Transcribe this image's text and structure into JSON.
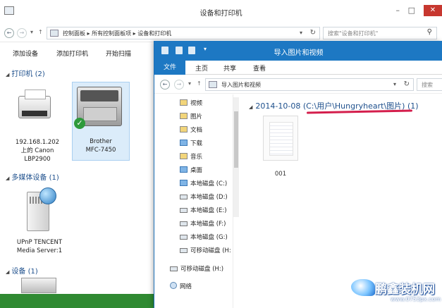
{
  "back_window": {
    "title": "设备和打印机",
    "breadcrumb": "控制面板 ▸ 所有控制面板项 ▸ 设备和打印机",
    "search_placeholder": "搜索\"设备和打印机\"",
    "toolbar": [
      "添加设备",
      "添加打印机",
      "开始扫描"
    ],
    "groups": {
      "printers": "打印机 (2)",
      "multimedia": "多媒体设备 (1)",
      "devices": "设备 (1)"
    },
    "printer_devices": [
      {
        "lines": [
          "192.168.1.202",
          "上的 Canon",
          "LBP2900"
        ]
      },
      {
        "lines": [
          "Brother",
          "MFC-7450"
        ]
      }
    ],
    "media_device": {
      "lines": [
        "UPnP TENCENT",
        "Media Server:1"
      ]
    }
  },
  "front_window": {
    "title": "导入图片和视频",
    "ribbon_tabs": [
      "文件",
      "主页",
      "共享",
      "查看"
    ],
    "breadcrumb": "导入图片和视频",
    "search_placeholder": "搜索",
    "nav_items": [
      "视频",
      "图片",
      "文档",
      "下载",
      "音乐",
      "桌面",
      "本地磁盘 (C:)",
      "本地磁盘 (D:)",
      "本地磁盘 (E:)",
      "本地磁盘 (F:)",
      "本地磁盘 (G:)",
      "可移动磁盘 (H:",
      "可移动磁盘 (H:)",
      "网络"
    ],
    "group_header": "2014-10-08 (C:\\用户\\Hungryheart\\图片) (1)",
    "item_label": "001"
  },
  "watermark": {
    "brand": "鹏鑫装机网",
    "url": "www.0753px.com"
  },
  "colors": {
    "front_title_bg": "#1d78c3",
    "annotation_underline": "#d41e4c",
    "bottom_bar": "#2f8a32"
  }
}
